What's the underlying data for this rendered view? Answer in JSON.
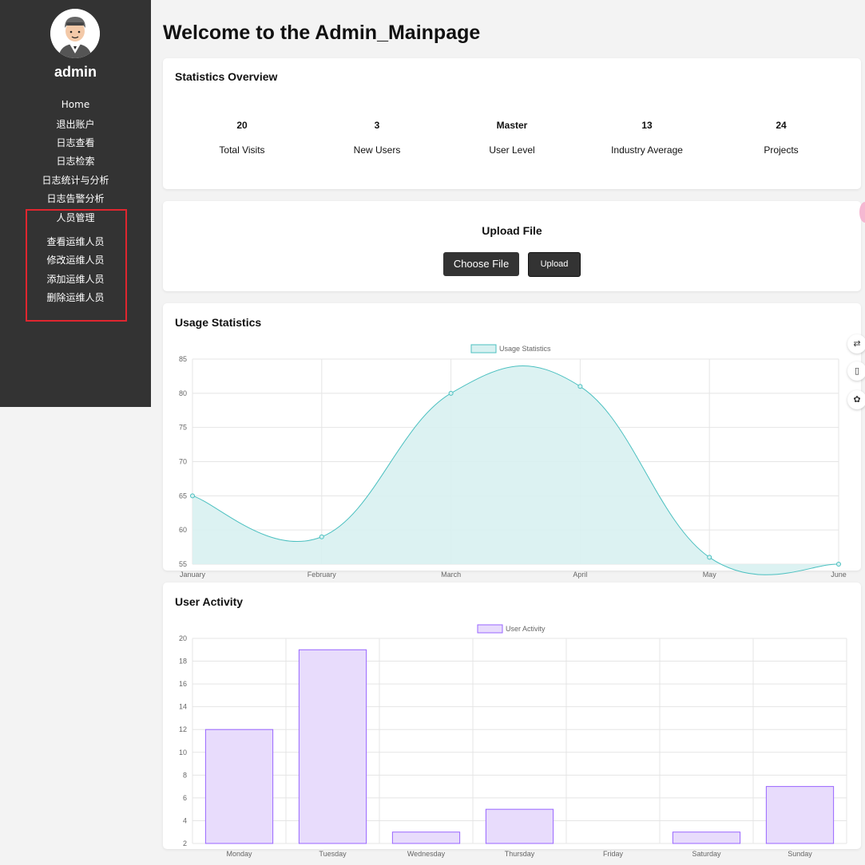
{
  "sidebar": {
    "username": "admin",
    "nav": [
      "Home",
      "退出账户",
      "日志查看",
      "日志检索",
      "日志统计与分析",
      "日志告警分析"
    ],
    "section": "人员管理",
    "sub": [
      "查看运维人员",
      "修改运维人员",
      "添加运维人员",
      "删除运维人员"
    ]
  },
  "main": {
    "title": "Welcome to the Admin_Mainpage"
  },
  "overview": {
    "title": "Statistics Overview",
    "stats": [
      {
        "value": "20",
        "label": "Total Visits"
      },
      {
        "value": "3",
        "label": "New Users"
      },
      {
        "value": "Master",
        "label": "User Level"
      },
      {
        "value": "13",
        "label": "Industry Average"
      },
      {
        "value": "24",
        "label": "Projects"
      }
    ]
  },
  "upload": {
    "title": "Upload File",
    "choose": "Choose File",
    "upload": "Upload"
  },
  "usage": {
    "title": "Usage Statistics"
  },
  "activity": {
    "title": "User Activity"
  },
  "colors": {
    "sidebar": "#333333",
    "line": "#4bc0c0",
    "area": "#d8f1f1",
    "bar": "#e8dcfc",
    "barBorder": "#9966ff"
  },
  "chart_data": [
    {
      "type": "area",
      "legend": "Usage Statistics",
      "categories": [
        "January",
        "February",
        "March",
        "April",
        "May",
        "June"
      ],
      "values": [
        65,
        59,
        80,
        81,
        56,
        55
      ],
      "ylim": [
        55,
        85
      ],
      "yticks": [
        55,
        60,
        65,
        70,
        75,
        80,
        85
      ],
      "grid": true,
      "legend_position": "top"
    },
    {
      "type": "bar",
      "legend": "User Activity",
      "categories": [
        "Monday",
        "Tuesday",
        "Wednesday",
        "Thursday",
        "Friday",
        "Saturday",
        "Sunday"
      ],
      "values": [
        12,
        19,
        3,
        5,
        2,
        3,
        7
      ],
      "ylim": [
        2,
        20
      ],
      "yticks": [
        2,
        4,
        6,
        8,
        10,
        12,
        14,
        16,
        18,
        20
      ],
      "grid": true,
      "legend_position": "top"
    }
  ]
}
